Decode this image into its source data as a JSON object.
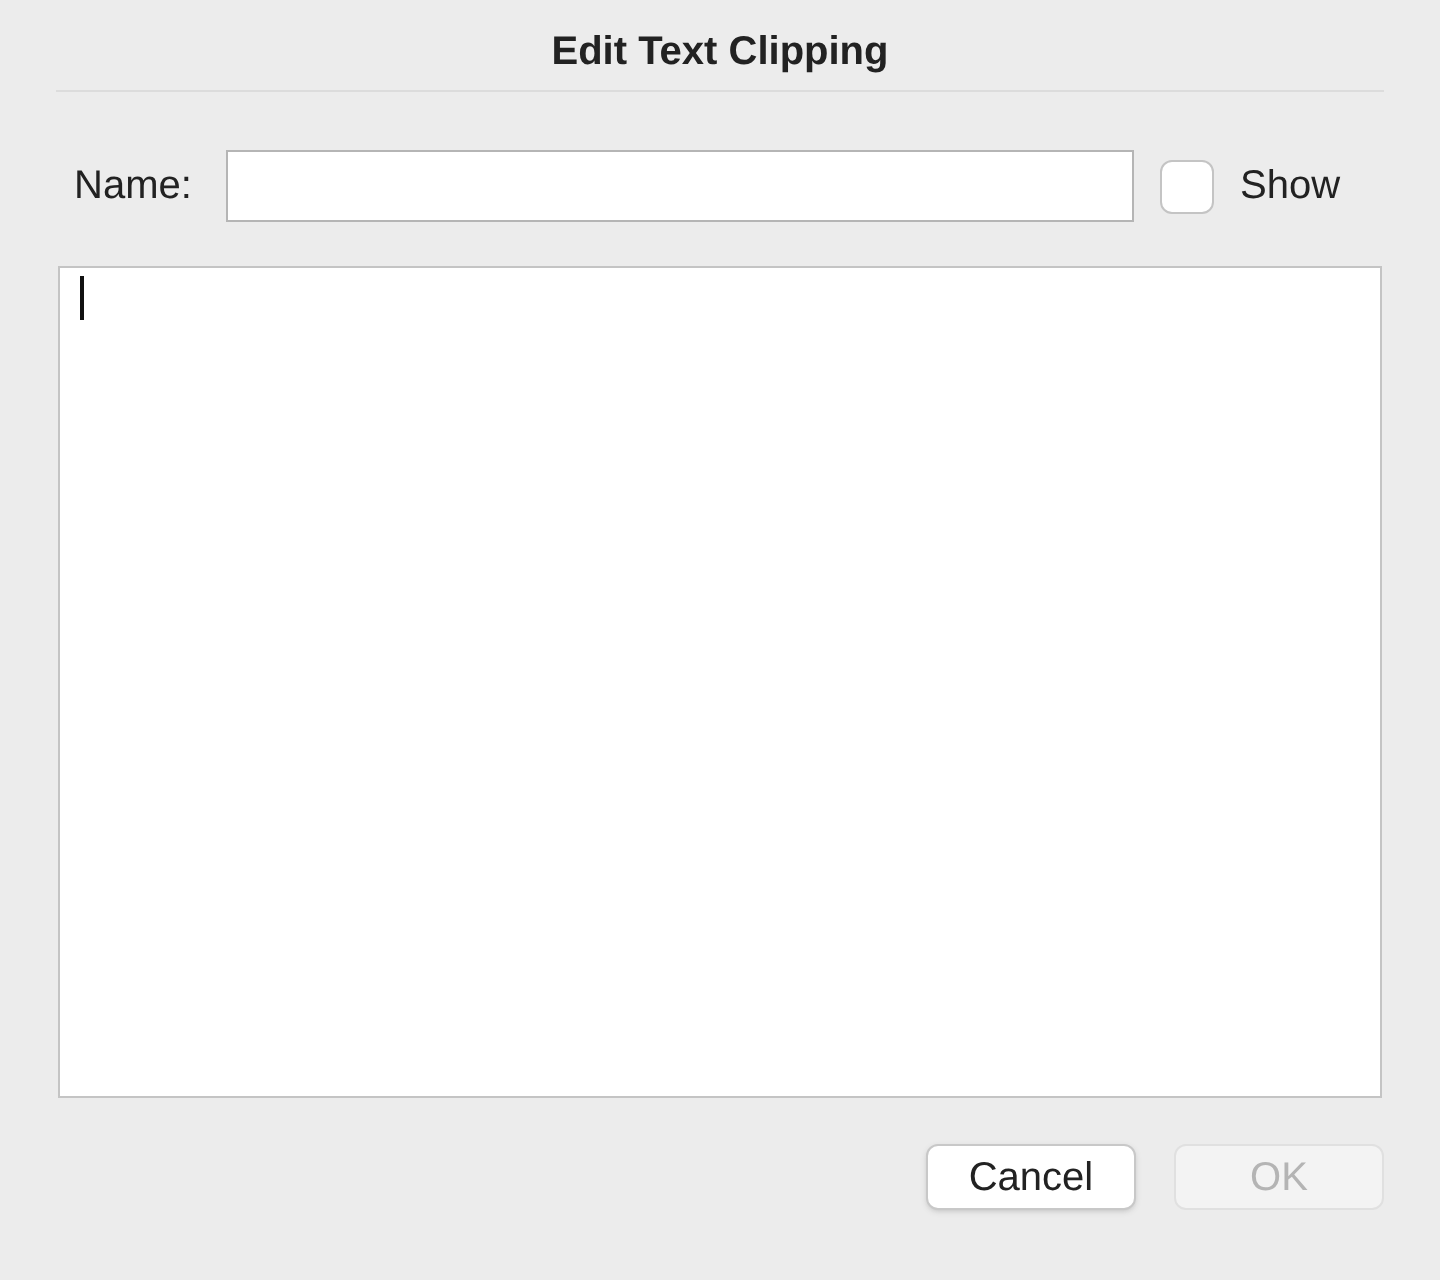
{
  "window": {
    "title": "Edit Text Clipping"
  },
  "name_field": {
    "label": "Name:"
  },
  "show_checkbox": {
    "label": "Show",
    "checked": false
  },
  "text_area": {
    "focused": true
  },
  "buttons": [
    {
      "label": "Cancel",
      "disabled": false
    },
    {
      "label": "OK",
      "disabled": true
    }
  ]
}
